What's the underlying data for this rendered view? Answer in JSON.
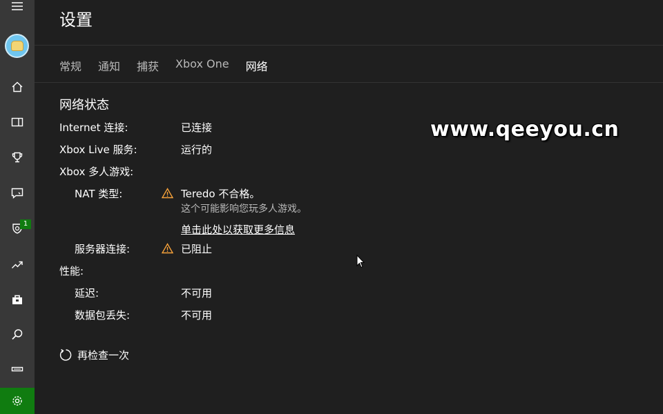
{
  "window": {
    "title": "设置"
  },
  "tabs": [
    {
      "label": "常规"
    },
    {
      "label": "通知"
    },
    {
      "label": "捕获"
    },
    {
      "label": "Xbox One"
    },
    {
      "label": "网络"
    }
  ],
  "network": {
    "section_title": "网络状态",
    "internet_label": "Internet 连接:",
    "internet_value": "已连接",
    "live_label": "Xbox Live 服务:",
    "live_value": "运行的",
    "multiplayer_label": "Xbox 多人游戏:",
    "nat_label": "NAT 类型:",
    "nat_value": "Teredo 不合格。",
    "nat_detail": "这个可能影响您玩多人游戏。",
    "more_info_link": "单击此处以获取更多信息",
    "server_label": "服务器连接:",
    "server_value": "已阻止",
    "performance_label": "性能:",
    "latency_label": "延迟:",
    "latency_value": "不可用",
    "packet_loss_label": "数据包丢失:",
    "packet_loss_value": "不可用",
    "recheck_label": "再检查一次"
  },
  "sidebar": {
    "badge_count": "1",
    "icons": [
      "hamburger-icon",
      "home-icon",
      "my-games-icon",
      "trophy-icon",
      "message-icon",
      "clubs-icon",
      "trending-icon",
      "store-icon",
      "search-icon",
      "connect-icon",
      "settings-icon"
    ]
  },
  "watermark": "www.qeeyou.cn",
  "colors": {
    "accent": "#107c10",
    "warning": "#f7a23a",
    "background": "#1f1f1f",
    "sidebar": "#383838"
  }
}
